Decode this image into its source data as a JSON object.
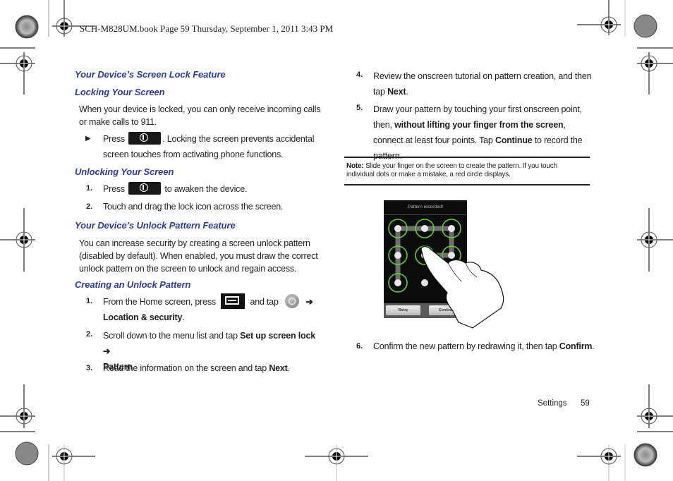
{
  "header": {
    "slug": "SCH-M828UM.book  Page 59  Thursday, September 1, 2011  3:43 PM"
  },
  "left_column": {
    "h_screen_lock": "Your Device’s Screen Lock Feature",
    "h_locking": "Locking Your Screen",
    "locking_intro": "When your device is locked, you can only receive incoming calls or make calls to 911.",
    "locking_bullet_pre": "Press",
    "locking_bullet_post": ". Locking the screen prevents accidental screen touches from activating phone functions.",
    "bullet_marker": "▶",
    "h_unlocking": "Unlocking Your Screen",
    "unlock_steps": [
      {
        "num": "1.",
        "pre": "Press",
        "post": "to awaken the device."
      },
      {
        "num": "2.",
        "text": "Touch and drag the lock icon across the screen."
      }
    ],
    "h_unlock_pattern": "Your Device’s Unlock Pattern Feature",
    "pattern_intro": "You can increase security by creating a screen unlock pattern (disabled by default). When enabled, you must draw the correct unlock pattern on the screen to unlock and regain access.",
    "h_creating": "Creating an Unlock Pattern",
    "create_steps": [
      {
        "num": "1.",
        "pre": "From the Home screen, press",
        "mid": "and tap",
        "arrow": "➔",
        "bold": "Location & security",
        "end": "."
      },
      {
        "num": "2.",
        "pre": "Scroll down to the menu list and tap ",
        "bold1": "Set up screen lock ➔",
        "bold2": "Pattern",
        "end": "."
      },
      {
        "num": "3.",
        "pre": "Read the information on the screen and tap ",
        "bold": "Next",
        "end": "."
      }
    ]
  },
  "right_column": {
    "steps": [
      {
        "num": "4.",
        "pre": "Review the onscreen tutorial on pattern creation, and then tap ",
        "bold": "Next",
        "end": "."
      },
      {
        "num": "5.",
        "pre": "Draw your pattern by touching your first onscreen point, then, ",
        "bold": "without lifting your finger from the screen",
        "mid": ", connect at least four points. Tap ",
        "bold2": "Continue",
        "end": " to record the pattern."
      },
      {
        "num": "6.",
        "pre": "Confirm the new pattern by redrawing it, then tap ",
        "bold": "Confirm",
        "end": "."
      }
    ],
    "note_label": "Note:",
    "note_text": "Slide your finger on the screen to create the pattern. If you touch individual dots or make a mistake, a red circle displays.",
    "phone": {
      "status_text": "Pattern recorded!",
      "retry_label": "Retry",
      "continue_label": "Continue",
      "accent_color": "#5fd12e"
    }
  },
  "footer": {
    "section": "Settings",
    "page_number": "59"
  }
}
